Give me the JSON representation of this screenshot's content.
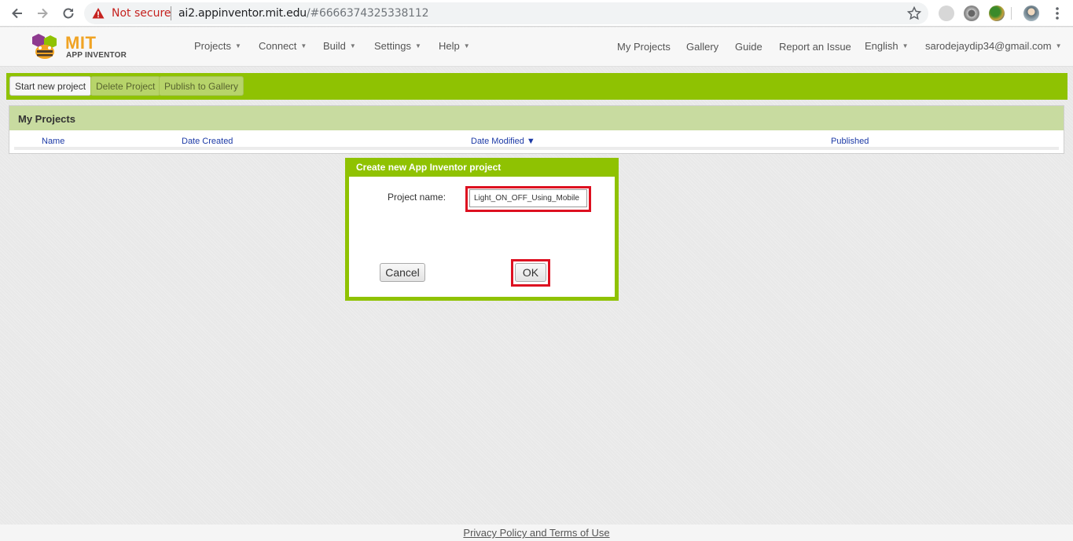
{
  "browser": {
    "security_label": "Not secure",
    "url_host": "ai2.appinventor.mit.edu",
    "url_path": "/#6666374325338112"
  },
  "app": {
    "logo_title": "MIT",
    "logo_subtitle": "APP INVENTOR",
    "menu": [
      "Projects",
      "Connect",
      "Build",
      "Settings",
      "Help"
    ],
    "right_links": [
      "My Projects",
      "Gallery",
      "Guide",
      "Report an Issue"
    ],
    "language": "English",
    "user": "sarodejaydip34@gmail.com"
  },
  "toolbar": {
    "start_new": "Start new project",
    "delete": "Delete Project",
    "publish": "Publish to Gallery"
  },
  "projects": {
    "title": "My Projects",
    "columns": {
      "name": "Name",
      "created": "Date Created",
      "modified": "Date Modified ▼",
      "published": "Published"
    }
  },
  "dialog": {
    "title": "Create new App Inventor project",
    "label": "Project name:",
    "value": "Light_ON_OFF_Using_Mobile",
    "cancel": "Cancel",
    "ok": "OK"
  },
  "footer": {
    "link": "Privacy Policy and Terms of Use"
  },
  "colors": {
    "accent_green": "#8fc202",
    "highlight_red": "#dd1020",
    "link_blue": "#1c3aa6"
  }
}
